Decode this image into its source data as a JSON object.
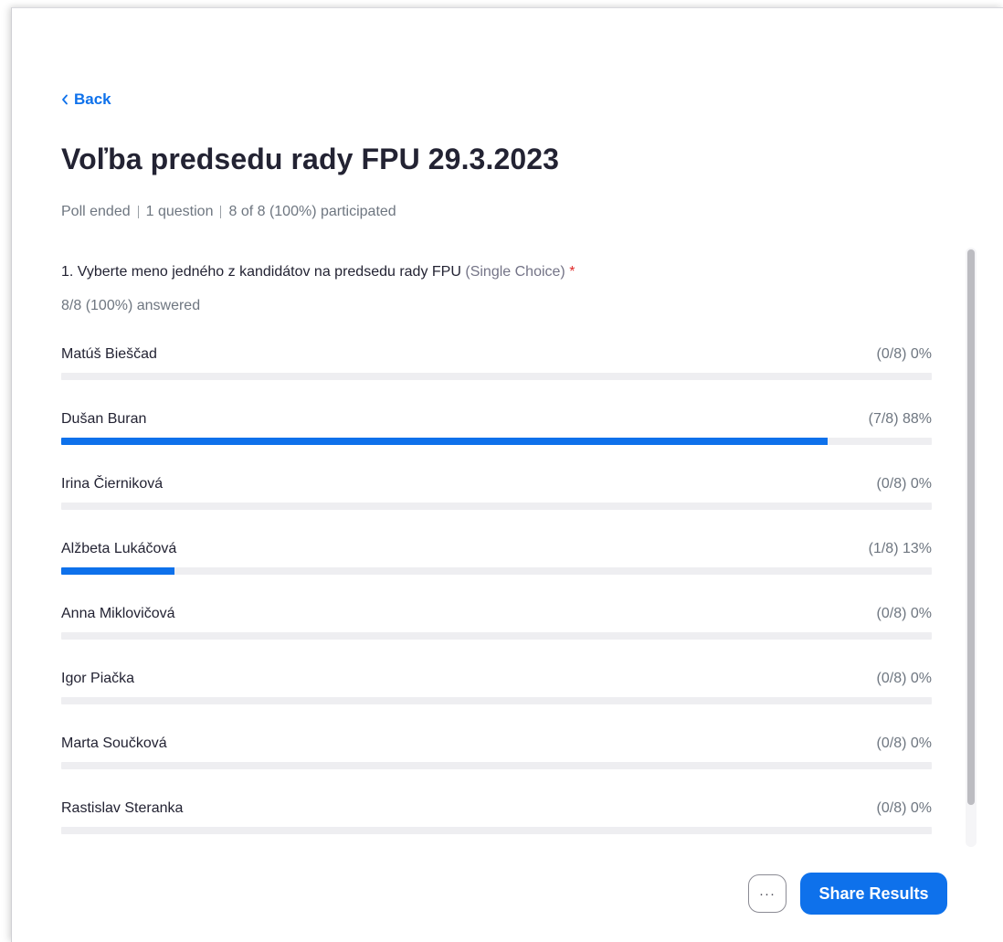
{
  "header": {
    "back_label": "Back",
    "title": "Voľba predsedu rady FPU 29.3.2023",
    "meta": [
      "Poll ended",
      "1 question",
      "8 of 8 (100%) participated"
    ]
  },
  "question": {
    "text": "1. Vyberte meno jedného z kandidátov na predsedu rady FPU",
    "type": "(Single Choice)",
    "required_mark": "*",
    "answered": "8/8 (100%) answered",
    "options": [
      {
        "label": "Matúš Bieščad",
        "result": "(0/8) 0%",
        "percent": 0
      },
      {
        "label": "Dušan Buran",
        "result": "(7/8) 88%",
        "percent": 88
      },
      {
        "label": "Irina Čierniková",
        "result": "(0/8) 0%",
        "percent": 0
      },
      {
        "label": "Alžbeta Lukáčová",
        "result": "(1/8) 13%",
        "percent": 13
      },
      {
        "label": "Anna Miklovičová",
        "result": "(0/8) 0%",
        "percent": 0
      },
      {
        "label": "Igor Piačka",
        "result": "(0/8) 0%",
        "percent": 0
      },
      {
        "label": "Marta Součková",
        "result": "(0/8) 0%",
        "percent": 0
      },
      {
        "label": "Rastislav Steranka",
        "result": "(0/8) 0%",
        "percent": 0
      }
    ]
  },
  "footer": {
    "more_label": "···",
    "share_label": "Share Results"
  },
  "colors": {
    "accent": "#0e71eb",
    "track": "#eeeef1",
    "muted_text": "#6e7680",
    "required": "#e02828"
  }
}
